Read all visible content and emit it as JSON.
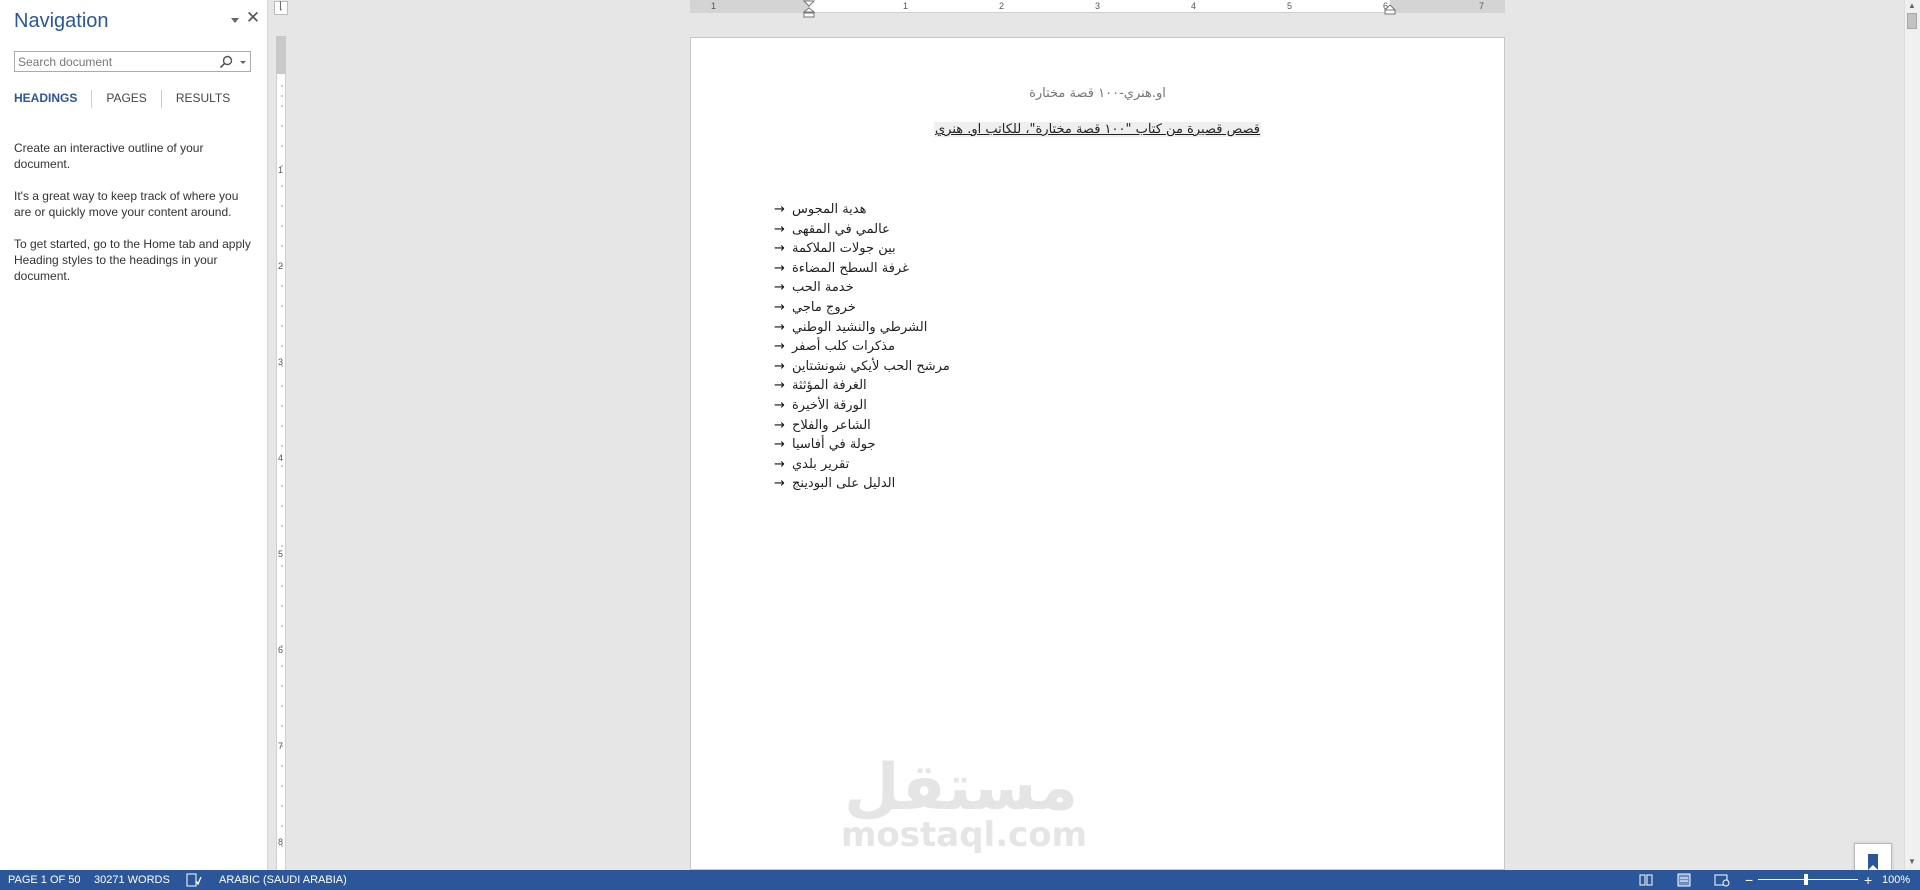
{
  "navigation": {
    "title": "Navigation",
    "search_placeholder": "Search document",
    "tabs": [
      {
        "label": "HEADINGS",
        "active": true
      },
      {
        "label": "PAGES",
        "active": false
      },
      {
        "label": "RESULTS",
        "active": false
      }
    ],
    "help": [
      "Create an interactive outline of your document.",
      "It's a great way to keep track of where you are or quickly move your content around.",
      "To get started, go to the Home tab and apply Heading styles to the headings in your document."
    ]
  },
  "ruler": {
    "horizontal_numbers": [
      "1",
      "1",
      "2",
      "3",
      "4",
      "5",
      "6",
      "7"
    ],
    "vertical_numbers": [
      "1",
      "2",
      "3",
      "4",
      "5",
      "6",
      "7",
      "8"
    ]
  },
  "document": {
    "header": "او.هنري-١٠٠ قصة مختارة",
    "title": "قصص قصيرة من كتاب \"١٠٠ قصة مختارة\"، للكاتب او. هنري",
    "list_arrow": "→",
    "stories": [
      "هدية المجوس",
      "عالمي في المقهى",
      "بين جولات الملاكمة",
      "غرفة السطح المضاءة",
      "خدمة الحب",
      "خروج ماجي",
      "الشرطي والنشيد الوطني",
      "مذكرات كلب أصفر",
      "مرشح الحب لأيكي شونشتاين",
      "الغرفة المؤثثة",
      "الورقة الأخيرة",
      "الشاعر والفلاح",
      "جولة في أفاسيا",
      "تقرير بلدي",
      "الدليل على البودينج"
    ],
    "watermark_ar": "مستقل",
    "watermark_en": "mostaql.com"
  },
  "status_bar": {
    "page": "PAGE 1 OF 50",
    "words": "30271 WORDS",
    "language": "ARABIC (SAUDI ARABIA)",
    "zoom": "100%"
  },
  "colors": {
    "accent": "#2b579a",
    "status_bar_bg": "#2b579a"
  }
}
